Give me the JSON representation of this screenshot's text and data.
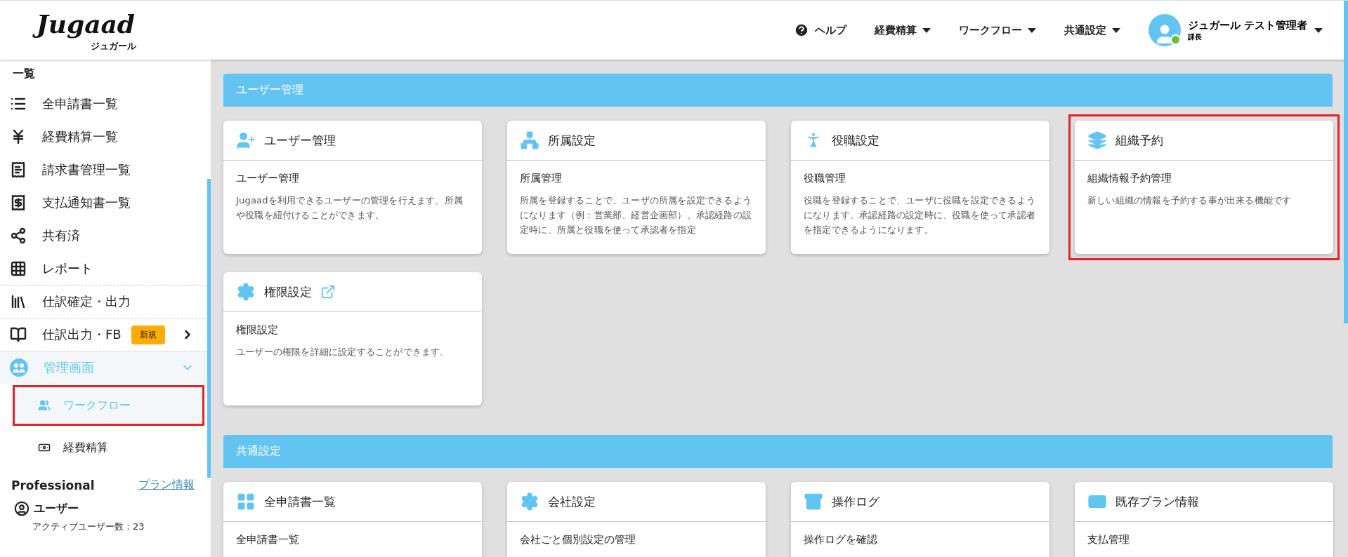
{
  "header": {
    "logo": {
      "name": "Jugaad",
      "sub": "ジュガール"
    },
    "nav": [
      {
        "kind": "help",
        "label": "ヘルプ"
      },
      {
        "kind": "menu",
        "label": "経費精算"
      },
      {
        "kind": "menu",
        "label": "ワークフロー"
      },
      {
        "kind": "menu",
        "label": "共通設定"
      }
    ],
    "user": {
      "name": "ジュガール テスト管理者",
      "role": "課長",
      "online": true
    }
  },
  "sidebar": {
    "heading": "一覧",
    "items": [
      {
        "label": "全申請書一覧",
        "divider_above": false
      },
      {
        "label": "経費精算一覧",
        "divider_above": false
      },
      {
        "label": "請求書管理一覧",
        "divider_above": false
      },
      {
        "label": "支払通知書一覧",
        "divider_above": false
      },
      {
        "label": "共有済",
        "divider_above": false
      },
      {
        "label": "レポート",
        "divider_above": false
      },
      {
        "label": "仕訳確定・出力",
        "divider_above": true
      },
      {
        "label": "仕訳出力・FB",
        "divider_above": true,
        "badge": "新規"
      },
      {
        "label": "管理画面",
        "divider_above": true,
        "expanded": true,
        "children": [
          {
            "label": "ワークフロー",
            "selected": true,
            "highlighted": true
          },
          {
            "label": "経費精算",
            "selected": false,
            "highlighted": false
          }
        ]
      }
    ],
    "plan": {
      "name": "Professional",
      "link": "プラン情報",
      "stat_title": "ユーザー",
      "stat_detail": "アクティブユーザー数：23"
    }
  },
  "sections": [
    {
      "title": "ユーザー管理",
      "cards": [
        {
          "title": "ユーザー管理",
          "external": false,
          "highlighted": false,
          "subtitle": "ユーザー管理",
          "description": "Jugaadを利用できるユーザーの管理を行えます。所属や役職を紐付けることができます。"
        },
        {
          "title": "所属設定",
          "external": false,
          "highlighted": false,
          "subtitle": "所属管理",
          "description": "所属を登録することで、ユーザの所属を設定できるようになります（例：営業部、経営企画部）。承認経路の設定時に、所属と役職を使って承認者を指定"
        },
        {
          "title": "役職設定",
          "external": false,
          "highlighted": false,
          "subtitle": "役職管理",
          "description": "役職を登録することで、ユーザに役職を設定できるようになります。承認経路の設定時に、役職を使って承認者を指定できるようになります。"
        },
        {
          "title": "組織予約",
          "external": false,
          "highlighted": true,
          "subtitle": "組織情報予約管理",
          "description": "新しい組織の情報を予約する事が出来る機能です"
        },
        {
          "title": "権限設定",
          "external": true,
          "highlighted": false,
          "subtitle": "権限設定",
          "description": "ユーザーの権限を詳細に設定することができます。"
        }
      ]
    },
    {
      "title": "共通設定",
      "cards": [
        {
          "title": "全申請書一覧",
          "external": false,
          "highlighted": false,
          "subtitle": "全申請書一覧"
        },
        {
          "title": "会社設定",
          "external": false,
          "highlighted": false,
          "subtitle": "会社ごと個別設定の管理"
        },
        {
          "title": "操作ログ",
          "external": false,
          "highlighted": false,
          "subtitle": "操作ログを確認"
        },
        {
          "title": "既存プラン情報",
          "external": false,
          "highlighted": false,
          "subtitle": "支払管理"
        }
      ]
    }
  ]
}
